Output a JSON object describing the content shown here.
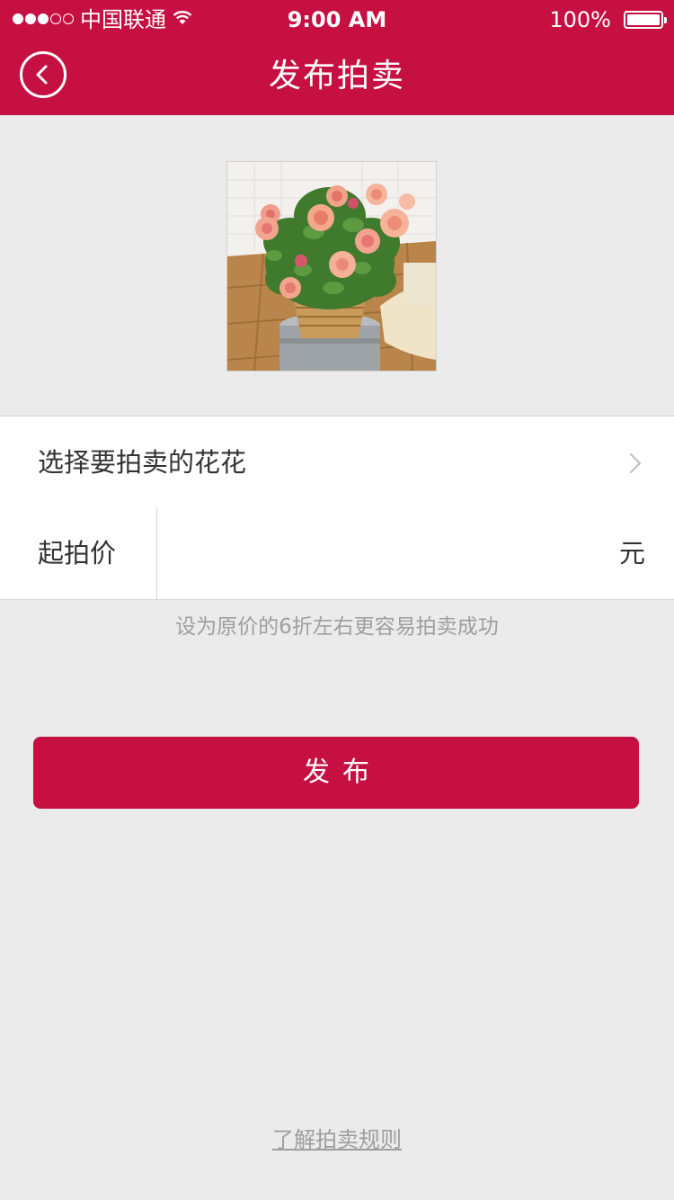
{
  "status_bar": {
    "carrier": "中国联通",
    "time": "9:00 AM",
    "battery": "100%",
    "signal_bars_filled": 3,
    "signal_bars_total": 5
  },
  "header": {
    "title": "发布拍卖",
    "back_icon": "chevron-left-circle-icon",
    "background": "#c71042"
  },
  "product_image": {
    "subject": "potted-roses-photo"
  },
  "select_row": {
    "label": "选择要拍卖的花花",
    "icon": "chevron-right-icon"
  },
  "price_row": {
    "label": "起拍价",
    "value": "",
    "placeholder": "",
    "unit": "元"
  },
  "hint": "设为原价的6折左右更容易拍卖成功",
  "publish_button": {
    "label": "发布",
    "background": "#c71042"
  },
  "rules_link": "了解拍卖规则"
}
